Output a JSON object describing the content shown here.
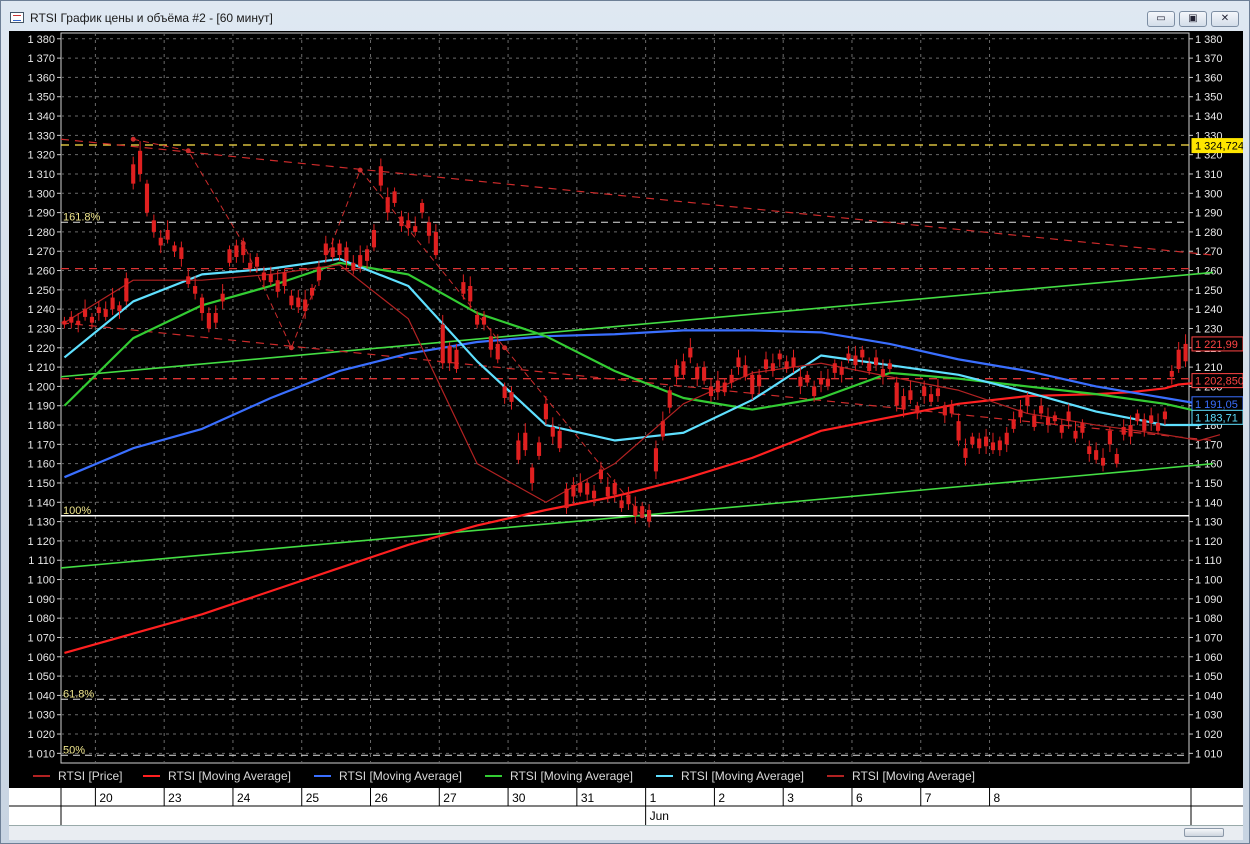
{
  "window": {
    "title": "RTSI График цены и объёма #2 - [60 минут]",
    "minimize_icon": "minimize-icon",
    "maximize_icon": "maximize-icon",
    "close_icon": "close-icon",
    "minimize_glyph": "▭",
    "maximize_glyph": "▣",
    "close_glyph": "✕"
  },
  "legend": [
    {
      "label": "RTSI [Price]",
      "color": "#b22222"
    },
    {
      "label": "RTSI [Moving Average]",
      "color": "#ff2020"
    },
    {
      "label": "RTSI [Moving Average]",
      "color": "#3a6fff"
    },
    {
      "label": "RTSI [Moving Average]",
      "color": "#33cc33"
    },
    {
      "label": "RTSI [Moving Average]",
      "color": "#5fe0ff"
    },
    {
      "label": "RTSI [Moving Average]",
      "color": "#b22222"
    }
  ],
  "chart_data": {
    "type": "candlestick",
    "ylim": [
      1005,
      1383
    ],
    "yticks": [
      1010,
      1020,
      1030,
      1040,
      1050,
      1060,
      1070,
      1080,
      1090,
      1100,
      1110,
      1120,
      1130,
      1140,
      1150,
      1160,
      1170,
      1180,
      1190,
      1200,
      1210,
      1220,
      1230,
      1240,
      1250,
      1260,
      1270,
      1280,
      1290,
      1300,
      1310,
      1320,
      1330,
      1340,
      1350,
      1360,
      1370,
      1380
    ],
    "ytick_labels": [
      "1 010",
      "1 020",
      "1 030",
      "1 040",
      "1 050",
      "1 060",
      "1 070",
      "1 080",
      "1 090",
      "1 100",
      "1 110",
      "1 120",
      "1 130",
      "1 140",
      "1 150",
      "1 160",
      "1 170",
      "1 180",
      "1 190",
      "1 200",
      "1 210",
      "1 220",
      "1 230",
      "1 240",
      "1 250",
      "1 260",
      "1 270",
      "1 280",
      "1 290",
      "1 300",
      "1 310",
      "1 320",
      "1 330",
      "1 340",
      "1 350",
      "1 360",
      "1 370",
      "1 380"
    ],
    "x_days": [
      "20",
      "23",
      "24",
      "25",
      "26",
      "27",
      "30",
      "31",
      "1",
      "2",
      "3",
      "6",
      "7",
      "8"
    ],
    "month_label": "Jun",
    "month_start_index": 8,
    "hours_per_day": 10,
    "close": [
      1234,
      1233,
      1234,
      1236,
      1236,
      1238,
      1240,
      1240,
      1242,
      1256,
      1315,
      1310,
      1305,
      1280,
      1277,
      1276,
      1273,
      1266,
      1257,
      1248,
      1246,
      1230,
      1238,
      1248,
      1264,
      1273,
      1268,
      1264,
      1262,
      1259,
      1254,
      1255,
      1252,
      1247,
      1241,
      1245,
      1251,
      1262,
      1268,
      1272,
      1274,
      1265,
      1264,
      1262,
      1271,
      1281,
      1304,
      1298,
      1295,
      1288,
      1282,
      1283,
      1290,
      1285,
      1268,
      1232,
      1212,
      1219,
      1254,
      1244,
      1237,
      1232,
      1226,
      1214,
      1200,
      1192,
      1172,
      1167,
      1158,
      1171,
      1183,
      1179,
      1168,
      1147,
      1143,
      1150,
      1144,
      1146,
      1152,
      1148,
      1144,
      1141,
      1139,
      1138,
      1134,
      1136,
      1168,
      1182,
      1198,
      1205,
      1213,
      1215,
      1210,
      1203,
      1200,
      1197,
      1202,
      1206,
      1210,
      1211,
      1196,
      1206,
      1209,
      1212,
      1214,
      1213,
      1210,
      1205,
      1202,
      1200,
      1201,
      1204,
      1207,
      1210,
      1214,
      1216,
      1215,
      1212,
      1211,
      1209,
      1209,
      1190,
      1195,
      1193,
      1190,
      1195,
      1196,
      1195,
      1190,
      1186,
      1172,
      1168,
      1170,
      1173,
      1169,
      1171,
      1167,
      1176,
      1183,
      1188,
      1190,
      1185,
      1186,
      1184,
      1182,
      1180,
      1182,
      1177,
      1176,
      1169,
      1162,
      1163,
      1170,
      1165,
      1175,
      1180,
      1186,
      1183,
      1181,
      1181,
      1183,
      1208,
      1219,
      1222
    ],
    "open_offset": [
      -2,
      3,
      -2,
      4,
      -3,
      3,
      -4,
      6,
      -3,
      -12,
      -10,
      12,
      -15,
      6,
      -4,
      5,
      -3,
      6,
      -4,
      4,
      -8,
      8,
      -5,
      -4,
      7,
      -6,
      5,
      -3,
      5,
      -4,
      4,
      -6,
      7,
      -5,
      5,
      -6,
      -4,
      -7,
      6,
      -5,
      -6,
      7,
      -4,
      6,
      -6,
      -9,
      10,
      -8,
      6,
      -5,
      4,
      -3,
      5,
      -7,
      12,
      -20,
      9,
      -10,
      -6,
      8,
      -5,
      4,
      -7,
      8,
      -6,
      5,
      -10,
      9,
      -8,
      -7,
      8,
      -5,
      9,
      -10,
      6,
      -5,
      6,
      -4,
      5,
      -5,
      6,
      -4,
      5,
      -5,
      4,
      -6,
      -12,
      -8,
      -9,
      6,
      -7,
      5,
      -6,
      7,
      -5,
      6,
      -5,
      -4,
      5,
      -6,
      10,
      -6,
      5,
      -4,
      3,
      -4,
      5,
      -5,
      4,
      -5,
      3,
      -4,
      5,
      -4,
      3,
      -5,
      4,
      -4,
      4,
      -4,
      3,
      12,
      -7,
      5,
      -4,
      5,
      -4,
      4,
      -5,
      4,
      10,
      -5,
      4,
      -5,
      5,
      -4,
      5,
      -6,
      -5,
      -4,
      5,
      -6,
      4,
      -4,
      3,
      -4,
      5,
      -4,
      5,
      -4,
      5,
      -4,
      7,
      -5,
      4,
      -6,
      -4,
      -6,
      4,
      -4,
      4,
      -3,
      -10,
      -9,
      -4
    ],
    "moving_averages": [
      {
        "name": "RTSI [Moving Average]",
        "color": "#ff2020",
        "x": [
          0,
          10,
          20,
          30,
          40,
          50,
          60,
          70,
          80,
          90,
          100,
          110,
          120,
          130,
          140,
          150,
          155,
          160,
          162,
          165,
          168
        ],
        "y": [
          1062,
          1072,
          1082,
          1094,
          1106,
          1118,
          1128,
          1136,
          1143,
          1152,
          1163,
          1177,
          1184,
          1191,
          1195,
          1196,
          1197,
          1199,
          1201,
          1202,
          1203
        ]
      },
      {
        "name": "RTSI [Moving Average]",
        "color": "#3a6fff",
        "x": [
          0,
          10,
          20,
          30,
          40,
          50,
          60,
          70,
          80,
          90,
          100,
          110,
          120,
          130,
          140,
          150,
          160,
          165,
          168
        ],
        "y": [
          1153,
          1168,
          1178,
          1194,
          1208,
          1217,
          1223,
          1226,
          1227,
          1229,
          1229,
          1228,
          1222,
          1214,
          1208,
          1200,
          1194,
          1191,
          1191
        ]
      },
      {
        "name": "RTSI [Moving Average]",
        "color": "#33cc33",
        "x": [
          0,
          10,
          20,
          30,
          40,
          50,
          60,
          70,
          80,
          90,
          100,
          110,
          120,
          130,
          140,
          150,
          160,
          165,
          168
        ],
        "y": [
          1190,
          1225,
          1242,
          1252,
          1264,
          1258,
          1238,
          1226,
          1208,
          1194,
          1188,
          1194,
          1207,
          1204,
          1200,
          1196,
          1191,
          1187,
          1187
        ]
      },
      {
        "name": "RTSI [Moving Average]",
        "color": "#5fe0ff",
        "x": [
          0,
          10,
          20,
          30,
          40,
          50,
          60,
          70,
          80,
          90,
          100,
          110,
          120,
          130,
          140,
          150,
          160,
          165,
          168
        ],
        "y": [
          1215,
          1244,
          1258,
          1261,
          1266,
          1252,
          1213,
          1180,
          1172,
          1176,
          1193,
          1216,
          1211,
          1206,
          1197,
          1187,
          1180,
          1180,
          1184
        ]
      },
      {
        "name": "RTSI [Moving Average]",
        "color": "#b22222",
        "x": [
          0,
          10,
          20,
          30,
          40,
          50,
          60,
          70,
          80,
          90,
          100,
          110,
          120,
          130,
          140,
          150,
          160,
          165,
          168
        ],
        "y": [
          1233,
          1255,
          1255,
          1258,
          1263,
          1235,
          1160,
          1140,
          1160,
          1191,
          1207,
          1212,
          1205,
          1198,
          1186,
          1180,
          1175,
          1172,
          1175
        ]
      }
    ],
    "trendlines": [
      {
        "color": "#44dd44",
        "x": [
          0,
          167
        ],
        "y": [
          1205,
          1259
        ]
      },
      {
        "color": "#44dd44",
        "x": [
          0,
          167
        ],
        "y": [
          1106,
          1160
        ]
      }
    ],
    "dashed_trendlines": [
      {
        "color": "#cc2b2b",
        "x": [
          0,
          167
        ],
        "y": [
          1328,
          1268
        ]
      },
      {
        "color": "#cc2b2b",
        "x": [
          0,
          167
        ],
        "y": [
          1233,
          1172
        ]
      }
    ],
    "zigzag": {
      "color": "#cc2b2b",
      "x": [
        10,
        18,
        26,
        33,
        43,
        64,
        84
      ],
      "y": [
        1328,
        1322,
        1274,
        1220,
        1312,
        1220,
        1133
      ]
    },
    "fib_levels": [
      {
        "label": "161.8%",
        "value": 1285,
        "color": "#e0e0e0"
      },
      {
        "label": "100%",
        "value": 1133,
        "color": "#ffffff"
      },
      {
        "label": "61.8%",
        "value": 1038,
        "color": "#e0e0e0"
      },
      {
        "label": "50%",
        "value": 1009,
        "color": "#e0e0e0"
      }
    ],
    "hlines": [
      {
        "value": 1325,
        "color": "#ffe34a",
        "dash": true
      },
      {
        "value": 1261,
        "color": "#d33",
        "dash": true
      },
      {
        "value": 1204,
        "color": "#d33",
        "dash": true
      }
    ],
    "price_labels": [
      {
        "text": "1 324,724",
        "value": 1324.7,
        "bg": "#ffe600",
        "fg": "#000000"
      },
      {
        "text": "1 221,99",
        "value": 1222,
        "bg": "#000000",
        "fg": "#ff4444"
      },
      {
        "text": "1 202,850",
        "value": 1203,
        "bg": "#000000",
        "fg": "#ff4444"
      },
      {
        "text": "1 191,05",
        "value": 1191,
        "bg": "#000000",
        "fg": "#3a6fff"
      },
      {
        "text": "1 183,71",
        "value": 1184,
        "bg": "#000000",
        "fg": "#5fe0ff"
      }
    ]
  }
}
